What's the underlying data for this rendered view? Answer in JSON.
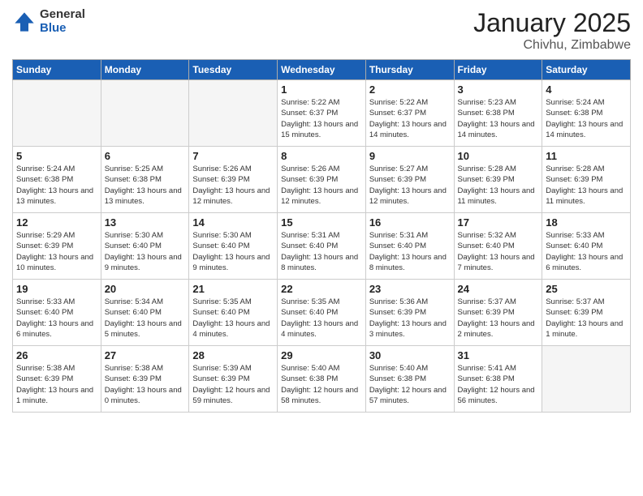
{
  "header": {
    "logo_general": "General",
    "logo_blue": "Blue",
    "month": "January 2025",
    "location": "Chivhu, Zimbabwe"
  },
  "weekdays": [
    "Sunday",
    "Monday",
    "Tuesday",
    "Wednesday",
    "Thursday",
    "Friday",
    "Saturday"
  ],
  "weeks": [
    [
      {
        "day": "",
        "sunrise": "",
        "sunset": "",
        "daylight": ""
      },
      {
        "day": "",
        "sunrise": "",
        "sunset": "",
        "daylight": ""
      },
      {
        "day": "",
        "sunrise": "",
        "sunset": "",
        "daylight": ""
      },
      {
        "day": "1",
        "sunrise": "Sunrise: 5:22 AM",
        "sunset": "Sunset: 6:37 PM",
        "daylight": "Daylight: 13 hours and 15 minutes."
      },
      {
        "day": "2",
        "sunrise": "Sunrise: 5:22 AM",
        "sunset": "Sunset: 6:37 PM",
        "daylight": "Daylight: 13 hours and 14 minutes."
      },
      {
        "day": "3",
        "sunrise": "Sunrise: 5:23 AM",
        "sunset": "Sunset: 6:38 PM",
        "daylight": "Daylight: 13 hours and 14 minutes."
      },
      {
        "day": "4",
        "sunrise": "Sunrise: 5:24 AM",
        "sunset": "Sunset: 6:38 PM",
        "daylight": "Daylight: 13 hours and 14 minutes."
      }
    ],
    [
      {
        "day": "5",
        "sunrise": "Sunrise: 5:24 AM",
        "sunset": "Sunset: 6:38 PM",
        "daylight": "Daylight: 13 hours and 13 minutes."
      },
      {
        "day": "6",
        "sunrise": "Sunrise: 5:25 AM",
        "sunset": "Sunset: 6:38 PM",
        "daylight": "Daylight: 13 hours and 13 minutes."
      },
      {
        "day": "7",
        "sunrise": "Sunrise: 5:26 AM",
        "sunset": "Sunset: 6:39 PM",
        "daylight": "Daylight: 13 hours and 12 minutes."
      },
      {
        "day": "8",
        "sunrise": "Sunrise: 5:26 AM",
        "sunset": "Sunset: 6:39 PM",
        "daylight": "Daylight: 13 hours and 12 minutes."
      },
      {
        "day": "9",
        "sunrise": "Sunrise: 5:27 AM",
        "sunset": "Sunset: 6:39 PM",
        "daylight": "Daylight: 13 hours and 12 minutes."
      },
      {
        "day": "10",
        "sunrise": "Sunrise: 5:28 AM",
        "sunset": "Sunset: 6:39 PM",
        "daylight": "Daylight: 13 hours and 11 minutes."
      },
      {
        "day": "11",
        "sunrise": "Sunrise: 5:28 AM",
        "sunset": "Sunset: 6:39 PM",
        "daylight": "Daylight: 13 hours and 11 minutes."
      }
    ],
    [
      {
        "day": "12",
        "sunrise": "Sunrise: 5:29 AM",
        "sunset": "Sunset: 6:39 PM",
        "daylight": "Daylight: 13 hours and 10 minutes."
      },
      {
        "day": "13",
        "sunrise": "Sunrise: 5:30 AM",
        "sunset": "Sunset: 6:40 PM",
        "daylight": "Daylight: 13 hours and 9 minutes."
      },
      {
        "day": "14",
        "sunrise": "Sunrise: 5:30 AM",
        "sunset": "Sunset: 6:40 PM",
        "daylight": "Daylight: 13 hours and 9 minutes."
      },
      {
        "day": "15",
        "sunrise": "Sunrise: 5:31 AM",
        "sunset": "Sunset: 6:40 PM",
        "daylight": "Daylight: 13 hours and 8 minutes."
      },
      {
        "day": "16",
        "sunrise": "Sunrise: 5:31 AM",
        "sunset": "Sunset: 6:40 PM",
        "daylight": "Daylight: 13 hours and 8 minutes."
      },
      {
        "day": "17",
        "sunrise": "Sunrise: 5:32 AM",
        "sunset": "Sunset: 6:40 PM",
        "daylight": "Daylight: 13 hours and 7 minutes."
      },
      {
        "day": "18",
        "sunrise": "Sunrise: 5:33 AM",
        "sunset": "Sunset: 6:40 PM",
        "daylight": "Daylight: 13 hours and 6 minutes."
      }
    ],
    [
      {
        "day": "19",
        "sunrise": "Sunrise: 5:33 AM",
        "sunset": "Sunset: 6:40 PM",
        "daylight": "Daylight: 13 hours and 6 minutes."
      },
      {
        "day": "20",
        "sunrise": "Sunrise: 5:34 AM",
        "sunset": "Sunset: 6:40 PM",
        "daylight": "Daylight: 13 hours and 5 minutes."
      },
      {
        "day": "21",
        "sunrise": "Sunrise: 5:35 AM",
        "sunset": "Sunset: 6:40 PM",
        "daylight": "Daylight: 13 hours and 4 minutes."
      },
      {
        "day": "22",
        "sunrise": "Sunrise: 5:35 AM",
        "sunset": "Sunset: 6:40 PM",
        "daylight": "Daylight: 13 hours and 4 minutes."
      },
      {
        "day": "23",
        "sunrise": "Sunrise: 5:36 AM",
        "sunset": "Sunset: 6:39 PM",
        "daylight": "Daylight: 13 hours and 3 minutes."
      },
      {
        "day": "24",
        "sunrise": "Sunrise: 5:37 AM",
        "sunset": "Sunset: 6:39 PM",
        "daylight": "Daylight: 13 hours and 2 minutes."
      },
      {
        "day": "25",
        "sunrise": "Sunrise: 5:37 AM",
        "sunset": "Sunset: 6:39 PM",
        "daylight": "Daylight: 13 hours and 1 minute."
      }
    ],
    [
      {
        "day": "26",
        "sunrise": "Sunrise: 5:38 AM",
        "sunset": "Sunset: 6:39 PM",
        "daylight": "Daylight: 13 hours and 1 minute."
      },
      {
        "day": "27",
        "sunrise": "Sunrise: 5:38 AM",
        "sunset": "Sunset: 6:39 PM",
        "daylight": "Daylight: 13 hours and 0 minutes."
      },
      {
        "day": "28",
        "sunrise": "Sunrise: 5:39 AM",
        "sunset": "Sunset: 6:39 PM",
        "daylight": "Daylight: 12 hours and 59 minutes."
      },
      {
        "day": "29",
        "sunrise": "Sunrise: 5:40 AM",
        "sunset": "Sunset: 6:38 PM",
        "daylight": "Daylight: 12 hours and 58 minutes."
      },
      {
        "day": "30",
        "sunrise": "Sunrise: 5:40 AM",
        "sunset": "Sunset: 6:38 PM",
        "daylight": "Daylight: 12 hours and 57 minutes."
      },
      {
        "day": "31",
        "sunrise": "Sunrise: 5:41 AM",
        "sunset": "Sunset: 6:38 PM",
        "daylight": "Daylight: 12 hours and 56 minutes."
      },
      {
        "day": "",
        "sunrise": "",
        "sunset": "",
        "daylight": ""
      }
    ]
  ]
}
